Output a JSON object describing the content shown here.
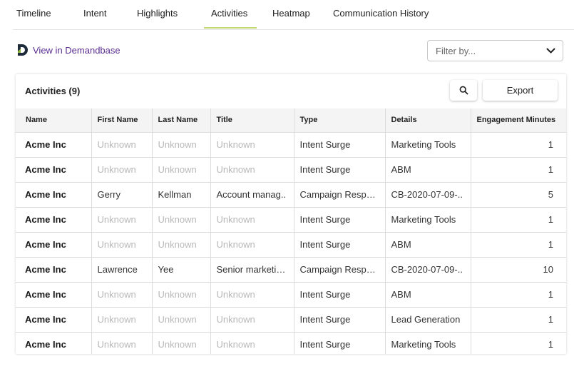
{
  "tabs": [
    {
      "label": "Timeline"
    },
    {
      "label": "Intent"
    },
    {
      "label": "Highlights"
    },
    {
      "label": "Activities"
    },
    {
      "label": "Heatmap"
    },
    {
      "label": "Communication History"
    }
  ],
  "active_tab": "Activities",
  "demandbase_link": "View in Demandbase",
  "filter": {
    "placeholder": "Filter by..."
  },
  "activities": {
    "title": "Activities (9)",
    "export_label": "Export",
    "columns": [
      "Name",
      "First Name",
      "Last Name",
      "Title",
      "Type",
      "Details",
      "Engagement Minutes"
    ],
    "rows": [
      {
        "name": "Acme Inc",
        "first": "Unknown",
        "last": "Unknown",
        "title": "Unknown",
        "type": "Intent Surge",
        "details": "Marketing Tools",
        "minutes": "1"
      },
      {
        "name": "Acme Inc",
        "first": "Unknown",
        "last": "Unknown",
        "title": "Unknown",
        "type": "Intent Surge",
        "details": "ABM",
        "minutes": "1"
      },
      {
        "name": "Acme Inc",
        "first": "Gerry",
        "last": "Kellman",
        "title": "Account manag..",
        "type": "Campaign Respon..",
        "details": "CB-2020-07-09-..",
        "minutes": "5"
      },
      {
        "name": "Acme Inc",
        "first": "Unknown",
        "last": "Unknown",
        "title": "Unknown",
        "type": "Intent Surge",
        "details": "Marketing Tools",
        "minutes": "1"
      },
      {
        "name": "Acme Inc",
        "first": "Unknown",
        "last": "Unknown",
        "title": "Unknown",
        "type": "Intent Surge",
        "details": "ABM",
        "minutes": "1"
      },
      {
        "name": "Acme Inc",
        "first": "Lawrence",
        "last": "Yee",
        "title": "Senior marketing..",
        "type": "Campaign Respon..",
        "details": "CB-2020-07-09-..",
        "minutes": "10"
      },
      {
        "name": "Acme Inc",
        "first": "Unknown",
        "last": "Unknown",
        "title": "Unknown",
        "type": "Intent Surge",
        "details": "ABM",
        "minutes": "1"
      },
      {
        "name": "Acme Inc",
        "first": "Unknown",
        "last": "Unknown",
        "title": "Unknown",
        "type": "Intent Surge",
        "details": "Lead Generation",
        "minutes": "1"
      },
      {
        "name": "Acme Inc",
        "first": "Unknown",
        "last": "Unknown",
        "title": "Unknown",
        "type": "Intent Surge",
        "details": "Marketing Tools",
        "minutes": "1"
      }
    ]
  },
  "colors": {
    "accent_underline": "#c4d873",
    "link": "#5a2d91",
    "placeholder_text": "#b8b8b8"
  },
  "icons": {
    "logo": "demandbase-logo-icon",
    "filter_chevron": "chevron-down-icon",
    "search": "search-icon"
  }
}
